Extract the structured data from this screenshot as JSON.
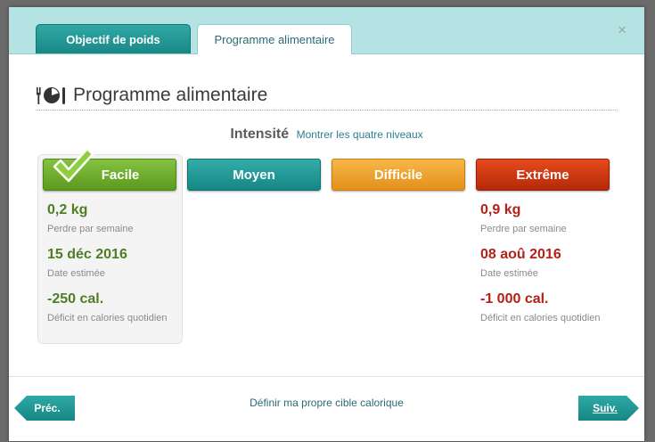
{
  "tabs": [
    {
      "label": "Objectif de poids",
      "active": true
    },
    {
      "label": "Programme alimentaire",
      "active": false
    }
  ],
  "close_glyph": "×",
  "section": {
    "title": "Programme alimentaire",
    "icon": "fork-plate-icon"
  },
  "intensity": {
    "label": "Intensité",
    "show_levels_link": "Montrer les quatre niveaux"
  },
  "levels": [
    {
      "label": "Facile",
      "color": "#6aaa2b",
      "selected": true
    },
    {
      "label": "Moyen",
      "color": "#1f9693",
      "selected": false
    },
    {
      "label": "Difficile",
      "color": "#f0a330",
      "selected": false
    },
    {
      "label": "Extrême",
      "color": "#cc3510",
      "selected": false
    }
  ],
  "easy_stats": {
    "loss_value": "0,2 kg",
    "loss_label": "Perdre par semaine",
    "date_value": "15 déc 2016",
    "date_label": "Date estimée",
    "deficit_value": "-250 cal.",
    "deficit_label": "Déficit en calories quotidien"
  },
  "extreme_stats": {
    "loss_value": "0,9 kg",
    "loss_label": "Perdre par semaine",
    "date_value": "08 aoû 2016",
    "date_label": "Date estimée",
    "deficit_value": "-1 000 cal.",
    "deficit_label": "Déficit en calories quotidien"
  },
  "footer": {
    "prev_label": "Préc.",
    "next_label": "Suiv.",
    "custom_target_link": "Définir ma propre cible calorique"
  }
}
